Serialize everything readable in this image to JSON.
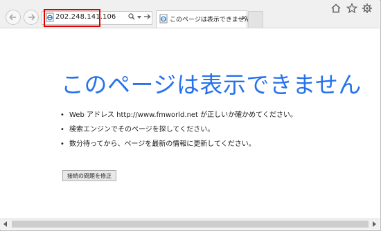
{
  "browser": {
    "address_bar": {
      "url": "202.248.141.106"
    },
    "tab": {
      "title": "このページは表示できません",
      "close_glyph": "×"
    },
    "icons": [
      "back-arrow",
      "forward-arrow",
      "ie-page-icon",
      "search-icon",
      "dropdown-icon",
      "go-arrow-icon",
      "home-icon",
      "favorites-star-icon",
      "tools-gear-icon"
    ],
    "highlight_color": "#e00000"
  },
  "page": {
    "heading": "このページは表示できません",
    "tips": [
      "Web アドレス http://www.fmworld.net が正しいか確かめてください。",
      "検索エンジンでそのページを探してください。",
      "数分待ってから、ページを最新の情報に更新してください。"
    ],
    "fix_button_label": "接続の問題を修正",
    "heading_color": "#2672ec"
  }
}
